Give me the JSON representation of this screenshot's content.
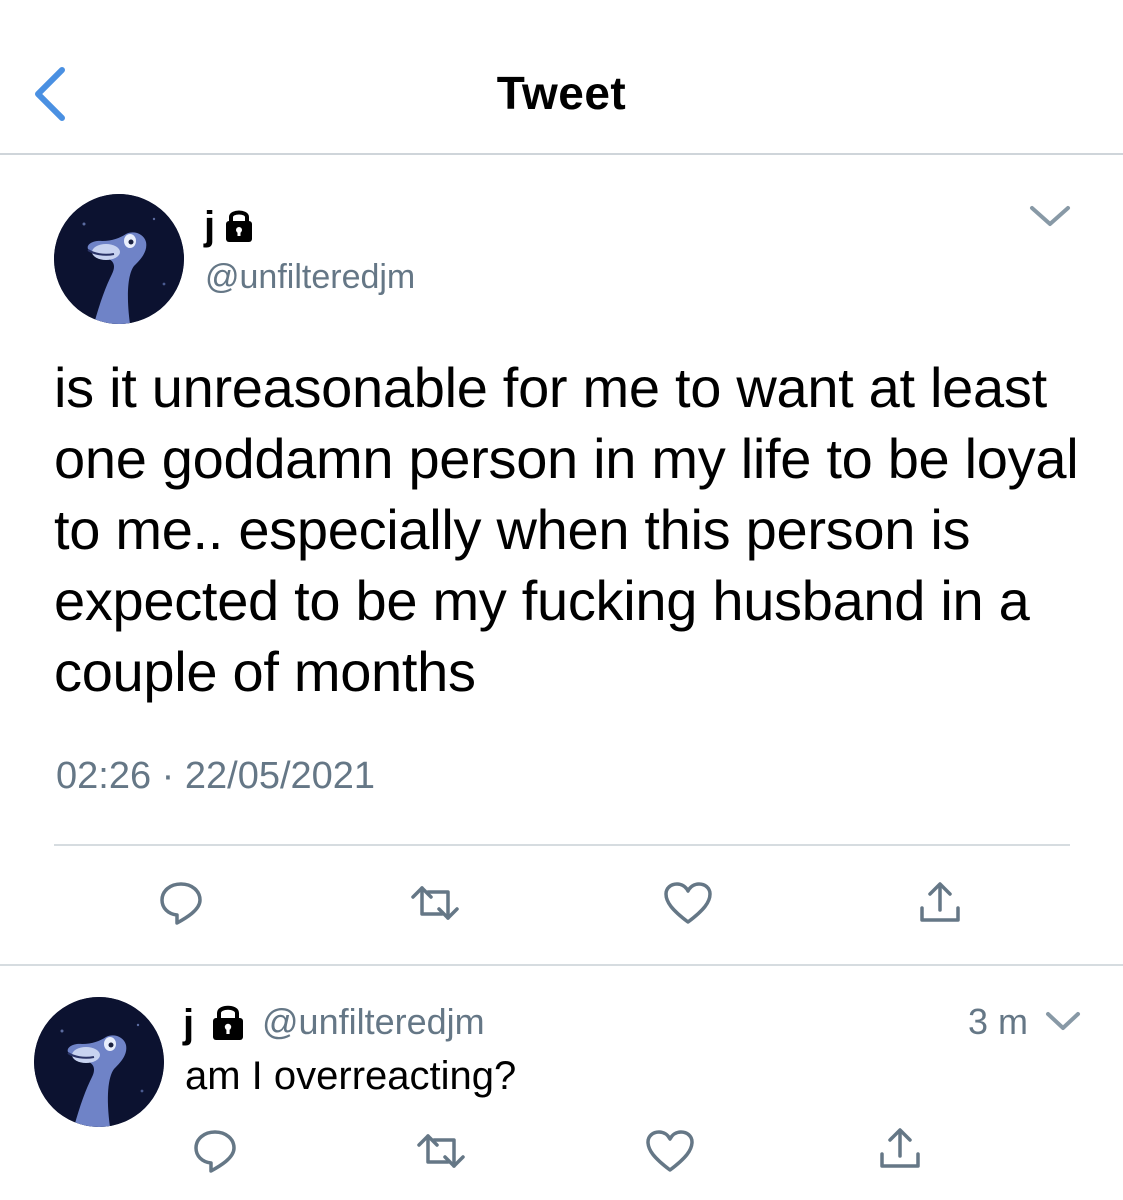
{
  "header": {
    "title": "Tweet",
    "back_icon": "chevron-left-icon",
    "accent_color": "#4a90e2"
  },
  "tweet": {
    "author": {
      "display_name": "j",
      "handle": "@unfilteredjm",
      "protected_icon": "lock-icon"
    },
    "text": "is it unreasonable for me to want at least one goddamn person in my life to be loyal to me.. especially when this person is expected to be my fucking husband in a couple of months",
    "time": "02:26",
    "separator": "·",
    "date": "22/05/2021",
    "actions": [
      "reply-icon",
      "retweet-icon",
      "like-icon",
      "share-icon"
    ],
    "menu_icon": "chevron-down-icon"
  },
  "reply": {
    "author": {
      "display_name": "j",
      "handle": "@unfilteredjm",
      "protected_icon": "lock-icon"
    },
    "time_ago": "3 m",
    "text": "am I overreacting?",
    "actions": [
      "reply-icon",
      "retweet-icon",
      "like-icon",
      "share-icon"
    ],
    "menu_icon": "chevron-down-icon"
  },
  "colors": {
    "secondary_text": "#657786",
    "icon_gray": "#657786",
    "divider": "#d6dce0"
  }
}
